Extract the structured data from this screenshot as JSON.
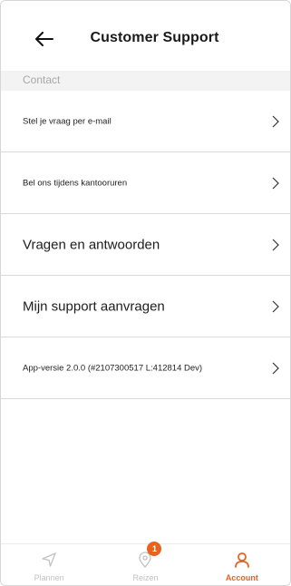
{
  "header": {
    "title": "Customer Support"
  },
  "section": {
    "label": "Contact"
  },
  "rows": [
    {
      "label": "Stel je vraag per e-mail",
      "size": "small"
    },
    {
      "label": "Bel ons tijdens kantooruren",
      "size": "small"
    },
    {
      "label": "Vragen en antwoorden",
      "size": "large"
    },
    {
      "label": "Mijn support aanvragen",
      "size": "large"
    },
    {
      "label": "App-versie 2.0.0 (#2107300517 L:412814 Dev)",
      "size": "small"
    }
  ],
  "tabs": [
    {
      "label": "Plannen",
      "icon": "navigation-arrow-icon",
      "active": false
    },
    {
      "label": "Reizen",
      "icon": "map-pin-icon",
      "active": false,
      "badge": "1"
    },
    {
      "label": "Account",
      "icon": "person-icon",
      "active": true
    }
  ],
  "colors": {
    "accent": "#e8631e",
    "section_bg": "#f3f3f3",
    "inactive": "#c2c2c2"
  }
}
